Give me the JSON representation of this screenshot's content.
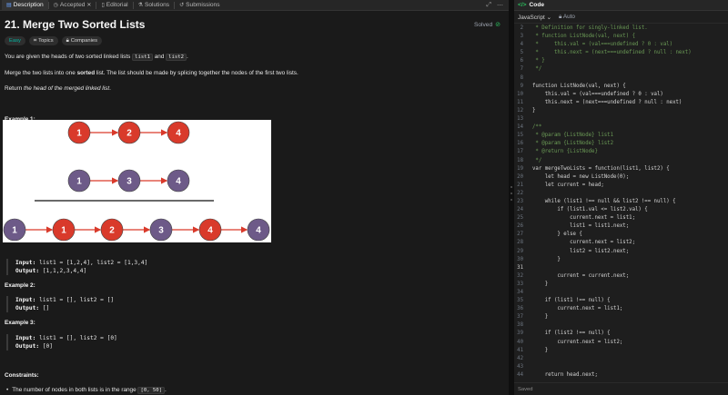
{
  "tabs": [
    {
      "label": "Description",
      "icon": "document-icon"
    },
    {
      "label": "Accepted",
      "icon": "clock-icon"
    },
    {
      "label": "Editorial",
      "icon": "book-icon"
    },
    {
      "label": "Solutions",
      "icon": "flask-icon"
    },
    {
      "label": "Submissions",
      "icon": "history-icon"
    }
  ],
  "problem": {
    "title": "21. Merge Two Sorted Lists",
    "solved_label": "Solved",
    "difficulty": "Easy",
    "topics_label": "Topics",
    "companies_label": "Companies",
    "p1_a": "You are given the heads of two sorted linked lists ",
    "p1_code1": "list1",
    "p1_b": " and ",
    "p1_code2": "list2",
    "p1_c": ".",
    "p2_a": "Merge the two lists into one ",
    "p2_bold": "sorted",
    "p2_b": " list. The list should be made by splicing together the nodes of the first two lists.",
    "p3_a": "Return ",
    "p3_ital": "the head of the merged linked list",
    "p3_b": ".",
    "example1_title": "Example 1:",
    "example1_input": "list1 = [1,2,4], list2 = [1,3,4]",
    "example1_output": "[1,1,2,3,4,4]",
    "example2_title": "Example 2:",
    "example2_input": "list1 = [], list2 = []",
    "example2_output": "[]",
    "example3_title": "Example 3:",
    "example3_input": "list1 = [], list2 = [0]",
    "example3_output": "[0]",
    "input_label": "Input:",
    "output_label": "Output:",
    "constraints_title": "Constraints:",
    "constraint1_a": "The number of nodes in both lists is in the range ",
    "constraint1_code": "[0, 50]",
    "constraint1_b": "."
  },
  "diagram": {
    "list1": [
      "1",
      "2",
      "4"
    ],
    "list2": [
      "1",
      "3",
      "4"
    ],
    "merged": [
      "1",
      "1",
      "2",
      "3",
      "4",
      "4"
    ],
    "colors": {
      "red": "#d93a2b",
      "purple": "#6d5a88"
    }
  },
  "editor": {
    "header": "Code",
    "language": "JavaScript",
    "autosave": "Auto",
    "status": "Saved",
    "lines": [
      {
        "n": "2",
        "t": " * Definition for singly-linked list.",
        "c": "#6a9955"
      },
      {
        "n": "3",
        "t": " * function ListNode(val, next) {",
        "c": "#6a9955"
      },
      {
        "n": "4",
        "t": " *     this.val = (val===undefined ? 0 : val)",
        "c": "#6a9955"
      },
      {
        "n": "5",
        "t": " *     this.next = (next===undefined ? null : next)",
        "c": "#6a9955"
      },
      {
        "n": "6",
        "t": " * }",
        "c": "#6a9955"
      },
      {
        "n": "7",
        "t": " */",
        "c": "#6a9955"
      },
      {
        "n": "8",
        "t": "",
        "c": "#d4d4d4"
      },
      {
        "n": "9",
        "t": "function ListNode(val, next) {",
        "c": "#d4d4d4"
      },
      {
        "n": "10",
        "t": "    this.val = (val===undefined ? 0 : val)",
        "c": "#d4d4d4"
      },
      {
        "n": "11",
        "t": "    this.next = (next===undefined ? null : next)",
        "c": "#d4d4d4"
      },
      {
        "n": "12",
        "t": "}",
        "c": "#d4d4d4"
      },
      {
        "n": "13",
        "t": "",
        "c": "#d4d4d4"
      },
      {
        "n": "14",
        "t": "/**",
        "c": "#6a9955"
      },
      {
        "n": "15",
        "t": " * @param {ListNode} list1",
        "c": "#6a9955"
      },
      {
        "n": "16",
        "t": " * @param {ListNode} list2",
        "c": "#6a9955"
      },
      {
        "n": "17",
        "t": " * @return {ListNode}",
        "c": "#6a9955"
      },
      {
        "n": "18",
        "t": " */",
        "c": "#6a9955"
      },
      {
        "n": "19",
        "t": "var mergeTwoLists = function(list1, list2) {",
        "c": "#d4d4d4"
      },
      {
        "n": "20",
        "t": "    let head = new ListNode(0);",
        "c": "#d4d4d4"
      },
      {
        "n": "21",
        "t": "    let current = head;",
        "c": "#d4d4d4"
      },
      {
        "n": "22",
        "t": "",
        "c": "#d4d4d4"
      },
      {
        "n": "23",
        "t": "    while (list1 !== null && list2 !== null) {",
        "c": "#d4d4d4"
      },
      {
        "n": "24",
        "t": "        if (list1.val <= list2.val) {",
        "c": "#d4d4d4"
      },
      {
        "n": "25",
        "t": "            current.next = list1;",
        "c": "#d4d4d4"
      },
      {
        "n": "26",
        "t": "            list1 = list1.next;",
        "c": "#d4d4d4"
      },
      {
        "n": "27",
        "t": "        } else {",
        "c": "#d4d4d4"
      },
      {
        "n": "28",
        "t": "            current.next = list2;",
        "c": "#d4d4d4"
      },
      {
        "n": "29",
        "t": "            list2 = list2.next;",
        "c": "#d4d4d4"
      },
      {
        "n": "30",
        "t": "        }",
        "c": "#d4d4d4"
      },
      {
        "n": "31",
        "t": "",
        "c": "#d4d4d4"
      },
      {
        "n": "32",
        "t": "        current = current.next;",
        "c": "#d4d4d4"
      },
      {
        "n": "33",
        "t": "    }",
        "c": "#d4d4d4"
      },
      {
        "n": "34",
        "t": "",
        "c": "#d4d4d4"
      },
      {
        "n": "35",
        "t": "    if (list1 !== null) {",
        "c": "#d4d4d4"
      },
      {
        "n": "36",
        "t": "        current.next = list1;",
        "c": "#d4d4d4"
      },
      {
        "n": "37",
        "t": "    }",
        "c": "#d4d4d4"
      },
      {
        "n": "38",
        "t": "",
        "c": "#d4d4d4"
      },
      {
        "n": "39",
        "t": "    if (list2 !== null) {",
        "c": "#d4d4d4"
      },
      {
        "n": "40",
        "t": "        current.next = list2;",
        "c": "#d4d4d4"
      },
      {
        "n": "41",
        "t": "    }",
        "c": "#d4d4d4"
      },
      {
        "n": "42",
        "t": "",
        "c": "#d4d4d4"
      },
      {
        "n": "43",
        "t": "",
        "c": "#d4d4d4"
      },
      {
        "n": "44",
        "t": "    return head.next;",
        "c": "#d4d4d4"
      }
    ]
  }
}
